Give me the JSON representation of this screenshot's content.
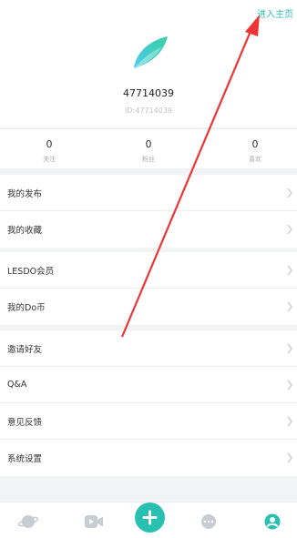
{
  "header": {
    "enter_home_label": "进入主页",
    "username": "47714039",
    "user_id": "ID:47714039"
  },
  "stats": [
    {
      "value": "0",
      "label": "关注"
    },
    {
      "value": "0",
      "label": "粉丝"
    },
    {
      "value": "0",
      "label": "喜欢"
    }
  ],
  "menu": {
    "group1": [
      {
        "label": "我的发布"
      },
      {
        "label": "我的收藏"
      }
    ],
    "group2": [
      {
        "label": "LESDO会员"
      },
      {
        "label": "我的Do币"
      }
    ],
    "group3": [
      {
        "label": "邀请好友"
      },
      {
        "label": "Q&A"
      },
      {
        "label": "意见反馈"
      },
      {
        "label": "系统设置"
      }
    ]
  },
  "tabbar": {
    "items": [
      {
        "icon": "planet-icon"
      },
      {
        "icon": "video-icon"
      },
      {
        "icon": "plus-icon"
      },
      {
        "icon": "chat-icon"
      },
      {
        "icon": "profile-icon"
      }
    ],
    "accent": "#27c0b1",
    "inactive": "#c8cdd3"
  },
  "colors": {
    "annotation_arrow": "#ee3535",
    "brand_teal": "#2bbfb0"
  }
}
